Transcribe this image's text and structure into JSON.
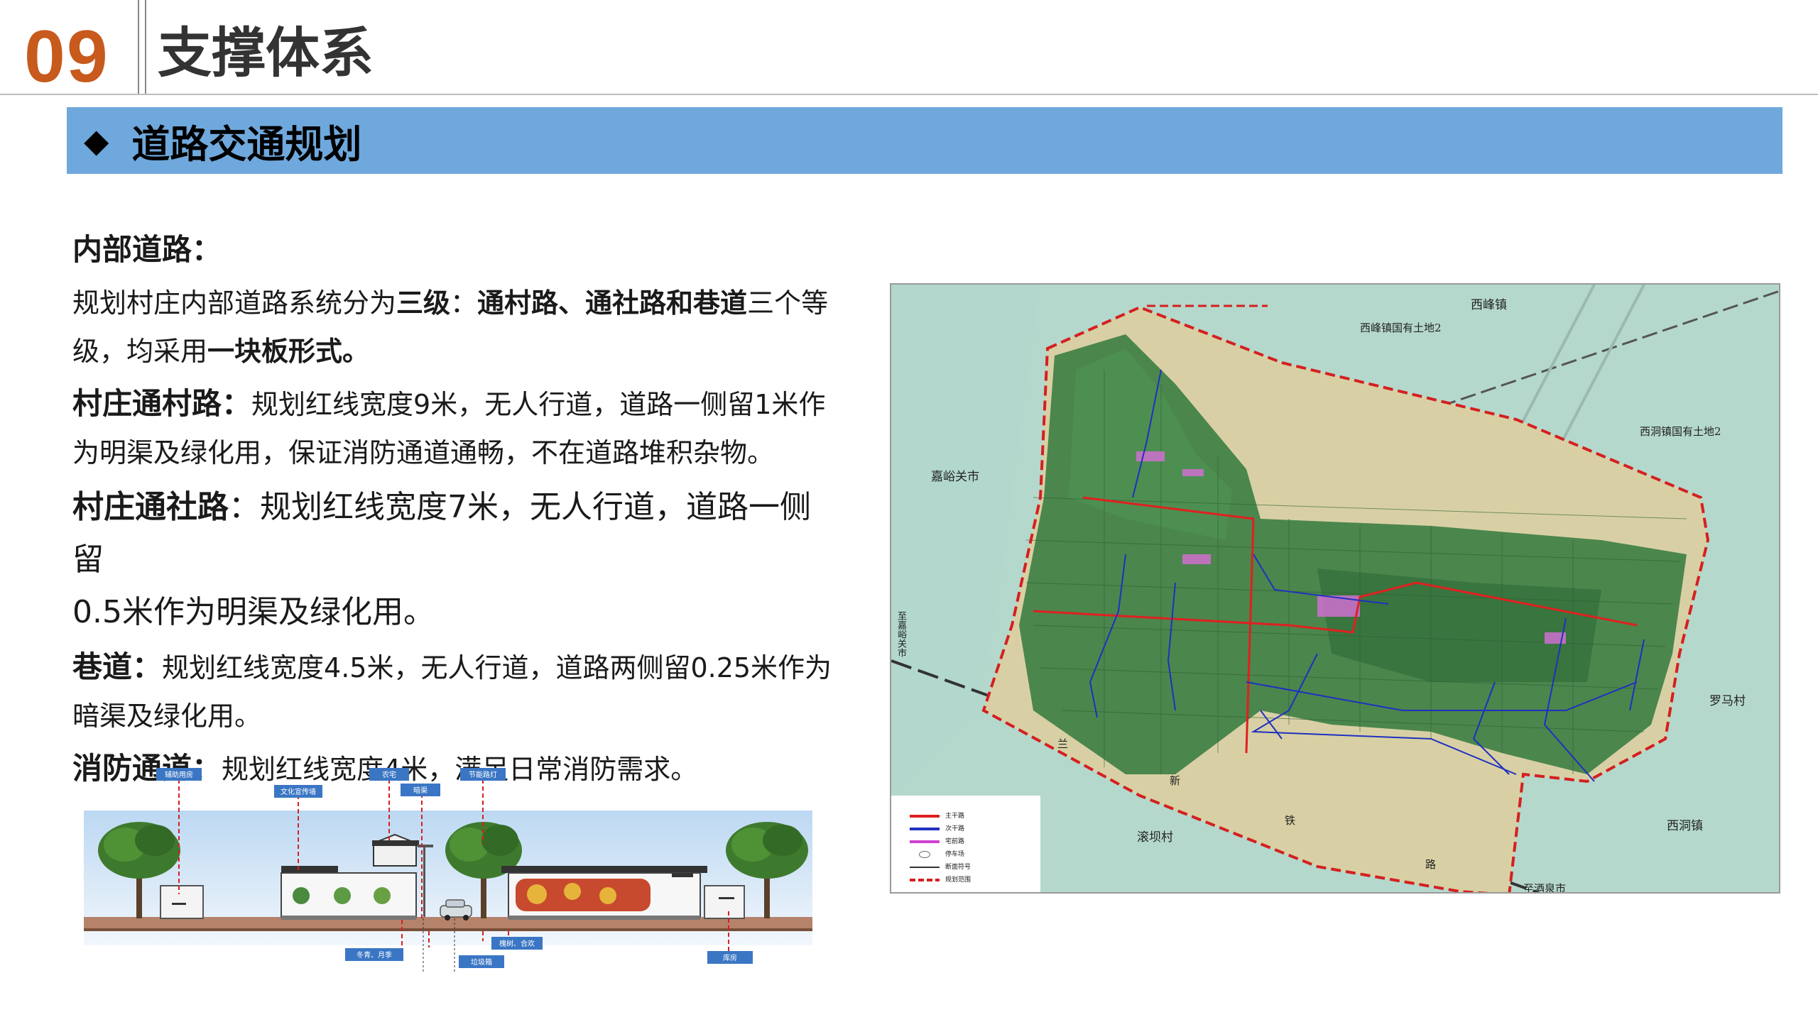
{
  "header": {
    "chapter_number": "09",
    "chapter_title": "支撑体系"
  },
  "section": {
    "diamond": "◆",
    "title": "道路交通规划"
  },
  "content": {
    "heading": "内部道路：",
    "p1_a": "规划村庄内部道路系统分为",
    "p1_b": "三级",
    "p1_c": "：",
    "p1_d": "通村路、通社路和巷道",
    "p1_e": "三个等",
    "p1_f": "级，均采用",
    "p1_g": "一块板形式。",
    "p2_label": "村庄通村路：",
    "p2_a": "规划红线宽度9米，无人行道，道路一侧留1米作",
    "p2_b": "为明渠及绿化用，保证消防通道通畅，不在道路堆积杂物。",
    "p3_label": "村庄通社路",
    "p3_a": "：规划红线宽度7米，无人行道，道路一侧留",
    "p3_b": "0.5米作为明渠及绿化用。",
    "p4_label": "巷道：",
    "p4_a": "规划红线宽度4.5米，无人行道，道路两侧留0.25米作为",
    "p4_b": "暗渠及绿化用。",
    "p5_label": "消防通道：",
    "p5_a": "规划红线宽度4米，满足日常消防需求。"
  },
  "diagram": {
    "labels": {
      "fuzhu": "辅助用房",
      "wenhua": "文化宣传墙",
      "nongzhai": "农宅",
      "anqu": "暗渠",
      "jieneng": "节能路灯",
      "dongqing": "冬青、月季",
      "huaishu": "槐树、合欢",
      "laji": "垃圾箱",
      "kufang": "库房"
    }
  },
  "map": {
    "labels": {
      "xifeng_town": "西峰镇",
      "xifeng_land": "西峰镇国有土地2",
      "xidong_land": "西洞镇国有土地2",
      "jiayuguan": "嘉峪关市",
      "to_jiayuguan": "至嘉峪关市",
      "luoma": "罗马村",
      "xidong_town": "西洞镇",
      "gunba": "滚坝村",
      "to_jiuquan": "至酒泉市",
      "lan": "兰",
      "xin": "新",
      "tie": "铁",
      "lu": "路"
    },
    "legend": [
      {
        "label": "主干路",
        "color": "#e02020",
        "dash": false
      },
      {
        "label": "次干路",
        "color": "#2030c0",
        "dash": false
      },
      {
        "label": "宅前路",
        "color": "#d040d0",
        "dash": false
      },
      {
        "label": "停车场",
        "color": "#666666",
        "dash": false
      },
      {
        "label": "断面符号",
        "color": "#333333",
        "dash": false
      },
      {
        "label": "规划范围",
        "color": "#d42020",
        "dash": true
      }
    ],
    "colors": {
      "water": "#a8d4c8",
      "desert": "#d9d2a8",
      "farmland": "#3f7f45",
      "boundary": "#d42020",
      "main_road": "#e02020",
      "secondary_road": "#2030c0"
    }
  }
}
